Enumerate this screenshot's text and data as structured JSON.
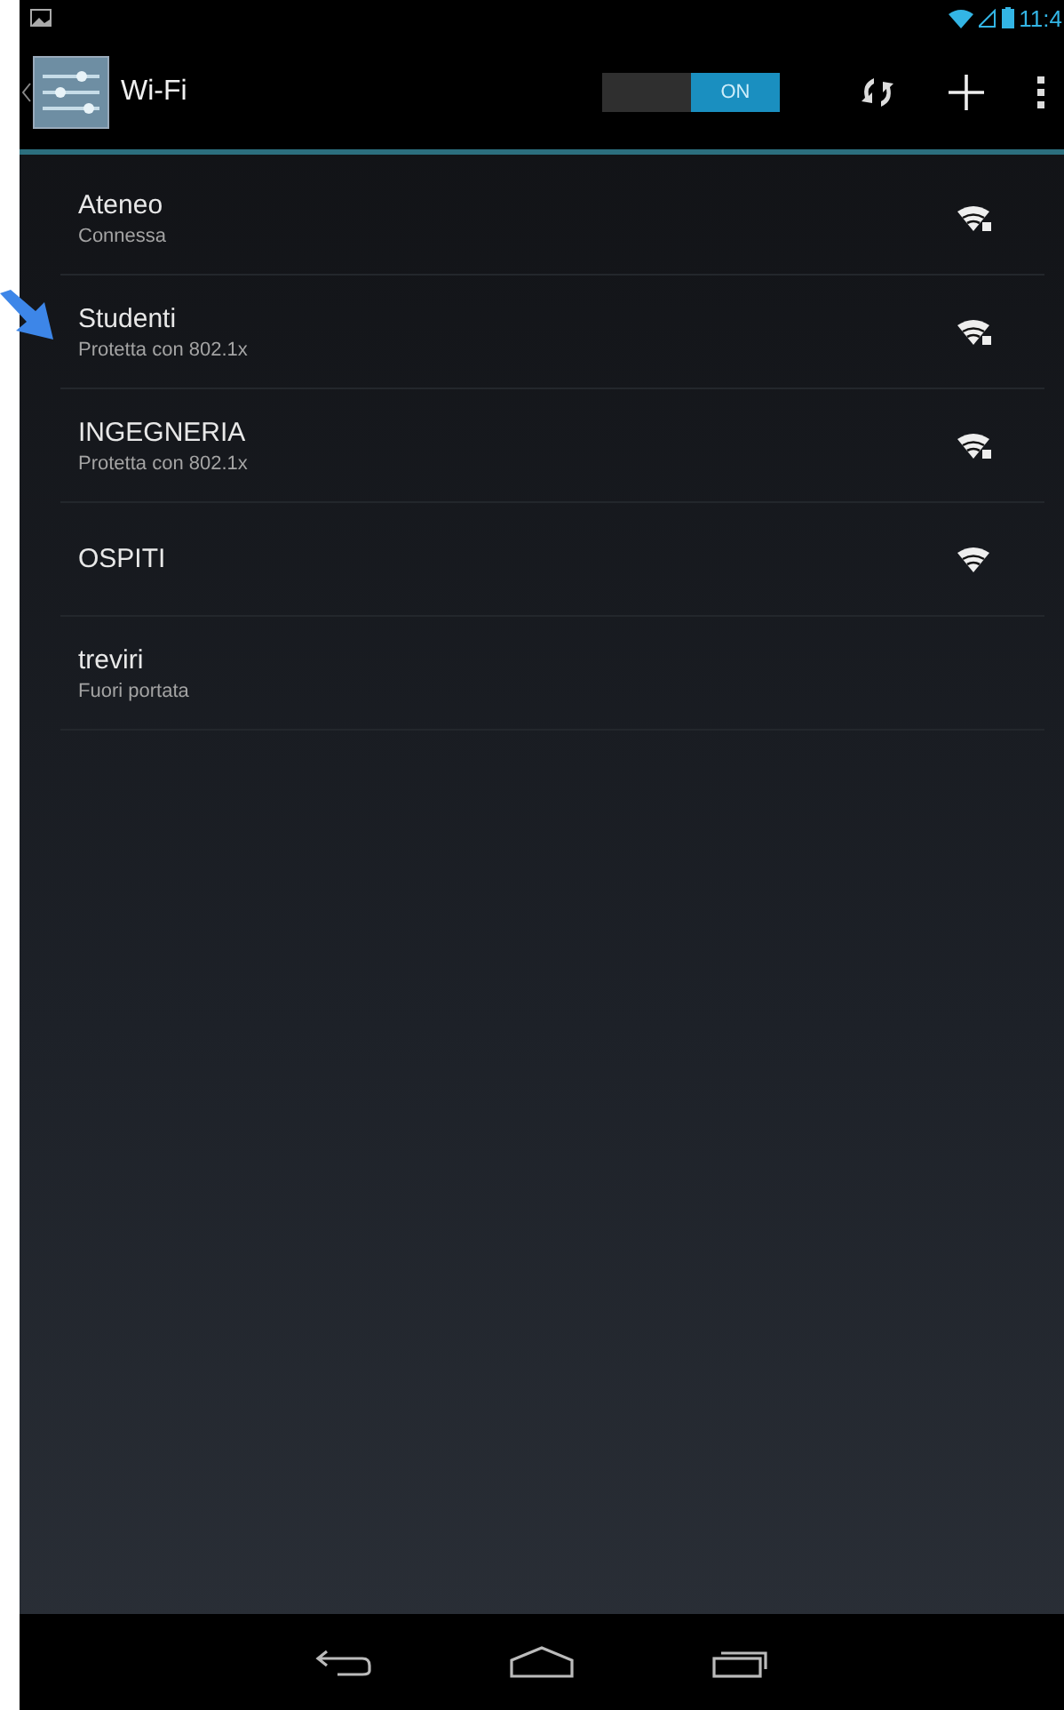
{
  "status_bar": {
    "time": "11:4"
  },
  "action_bar": {
    "title": "Wi-Fi",
    "toggle": {
      "label": "ON",
      "on": true
    }
  },
  "networks": [
    {
      "name": "Ateneo",
      "status": "Connessa",
      "secured": true,
      "in_range": true,
      "pointed": false
    },
    {
      "name": "Studenti",
      "status": "Protetta con 802.1x",
      "secured": true,
      "in_range": true,
      "pointed": true
    },
    {
      "name": "INGEGNERIA",
      "status": "Protetta con 802.1x",
      "secured": true,
      "in_range": true,
      "pointed": false
    },
    {
      "name": "OSPITI",
      "secured": false,
      "in_range": true,
      "pointed": false
    },
    {
      "name": "treviri",
      "status": "Fuori portata",
      "secured": false,
      "in_range": false,
      "pointed": false
    }
  ]
}
